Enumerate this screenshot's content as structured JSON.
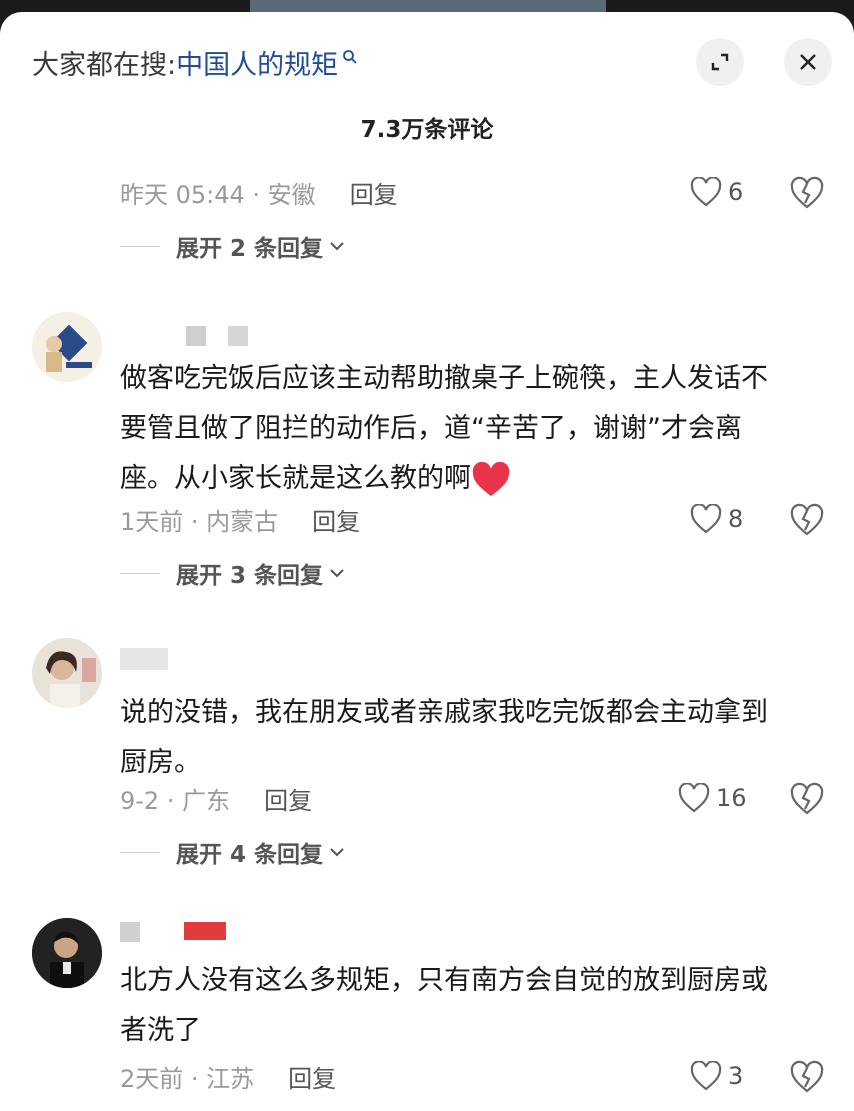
{
  "search": {
    "prefix": "大家都在搜: ",
    "term": "中国人的规矩"
  },
  "comment_count": "7.3万条评论",
  "comments": [
    {
      "text": [],
      "time_loc": "昨天 05:44 · 安徽",
      "reply_label": "回复",
      "likes": "6",
      "expand_label": "展开 2 条回复"
    },
    {
      "text": [
        "做客吃完饭后应该主动帮助撤桌子上碗筷，主人发话不",
        "要管且做了阻拦的动作后，道“辛苦了，谢谢”才会离",
        "座。从小家长就是这么教的啊"
      ],
      "emoji": "heart",
      "time_loc": "1天前 · 内蒙古",
      "reply_label": "回复",
      "likes": "8",
      "expand_label": "展开 3 条回复"
    },
    {
      "text": [
        "说的没错，我在朋友或者亲戚家我吃完饭都会主动拿到",
        "厨房。"
      ],
      "time_loc": "9-2 · 广东",
      "reply_label": "回复",
      "likes": "16",
      "expand_label": "展开 4 条回复"
    },
    {
      "text": [
        "北方人没有这么多规矩，只有南方会自觉的放到厨房或",
        "者洗了"
      ],
      "time_loc": "2天前 · 江苏",
      "reply_label": "回复",
      "likes": "3"
    }
  ],
  "colors": {
    "accent_link": "#1f4e96",
    "emoji_heart": "#e8334a"
  },
  "icons": [
    "search-icon",
    "expand-icon",
    "close-icon",
    "like-icon",
    "dislike-icon",
    "chevron-down-icon"
  ]
}
